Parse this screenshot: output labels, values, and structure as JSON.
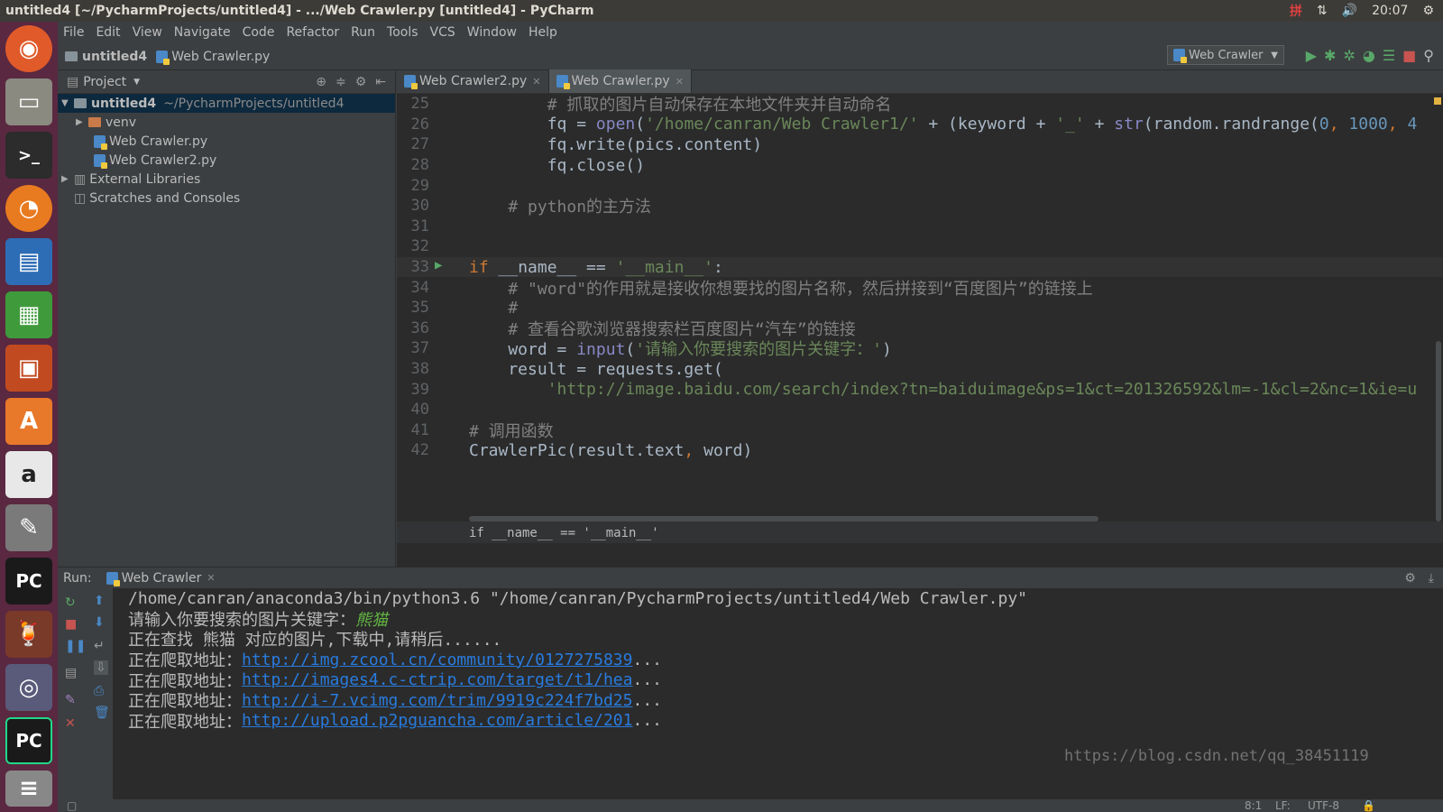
{
  "window": {
    "title": "untitled4 [~/PycharmProjects/untitled4] - .../Web Crawler.py [untitled4] - PyCharm",
    "tray": {
      "ime": "拼",
      "clock": "20:07"
    }
  },
  "menu": [
    "File",
    "Edit",
    "View",
    "Navigate",
    "Code",
    "Refactor",
    "Run",
    "Tools",
    "VCS",
    "Window",
    "Help"
  ],
  "nav": {
    "project": "untitled4",
    "file": "Web Crawler.py",
    "run_config": "Web Crawler"
  },
  "project_pane": {
    "title": "Project",
    "tree": [
      {
        "label": "untitled4",
        "path": "~/PycharmProjects/untitled4"
      },
      {
        "label": "venv"
      },
      {
        "label": "Web Crawler.py"
      },
      {
        "label": "Web Crawler2.py"
      },
      {
        "label": "External Libraries"
      },
      {
        "label": "Scratches and Consoles"
      }
    ]
  },
  "tabs": [
    {
      "label": "Web Crawler2.py"
    },
    {
      "label": "Web Crawler.py"
    }
  ],
  "code": {
    "lines": [
      {
        "n": "25",
        "t": "        # 抓取的图片自动保存在本地文件夹并自动命名"
      },
      {
        "n": "26",
        "t": "        fq = open('/home/canran/Web Crawler1/' + (keyword + '_' + str(random.randrange(0, 1000, 4"
      },
      {
        "n": "27",
        "t": "        fq.write(pics.content)"
      },
      {
        "n": "28",
        "t": "        fq.close()"
      },
      {
        "n": "29",
        "t": ""
      },
      {
        "n": "30",
        "t": "    # python的主方法"
      },
      {
        "n": "31",
        "t": ""
      },
      {
        "n": "32",
        "t": ""
      },
      {
        "n": "33",
        "t": "if __name__ == '__main__':"
      },
      {
        "n": "34",
        "t": "    # \"word\"的作用就是接收你想要找的图片名称，然后拼接到“百度图片”的链接上"
      },
      {
        "n": "35",
        "t": "    #"
      },
      {
        "n": "36",
        "t": "    # 查看谷歌浏览器搜索栏百度图片“汽车”的链接"
      },
      {
        "n": "37",
        "t": "    word = input('请输入你要搜索的图片关键字：')"
      },
      {
        "n": "38",
        "t": "    result = requests.get("
      },
      {
        "n": "39",
        "t": "        'http://image.baidu.com/search/index?tn=baiduimage&ps=1&ct=201326592&lm=-1&cl=2&nc=1&ie=u"
      },
      {
        "n": "40",
        "t": ""
      },
      {
        "n": "41",
        "t": "# 调用函数"
      },
      {
        "n": "42",
        "t": "CrawlerPic(result.text, word)"
      }
    ],
    "breadcrumb": "if __name__ == '__main__'"
  },
  "run": {
    "label": "Run:",
    "tab": "Web Crawler",
    "console": {
      "cmd": "/home/canran/anaconda3/bin/python3.6 \"/home/canran/PycharmProjects/untitled4/Web Crawler.py\"",
      "prompt": "请输入你要搜索的图片关键字：",
      "input": "熊猫",
      "searching": "正在查找 熊猫 对应的图片,下载中,请稍后......",
      "crawl_prefix": "正在爬取地址：",
      "ellipsis": "...",
      "urls": [
        "http://img.zcool.cn/community/0127275839",
        "http://images4.c-ctrip.com/target/t1/hea",
        "http://i-7.vcimg.com/trim/9919c224f7bd25",
        "http://upload.p2pguancha.com/article/201"
      ]
    }
  },
  "status": {
    "pos": "8:1",
    "lf": "LF:",
    "enc": "UTF-8"
  },
  "watermark": "https://blog.csdn.net/qq_38451119"
}
